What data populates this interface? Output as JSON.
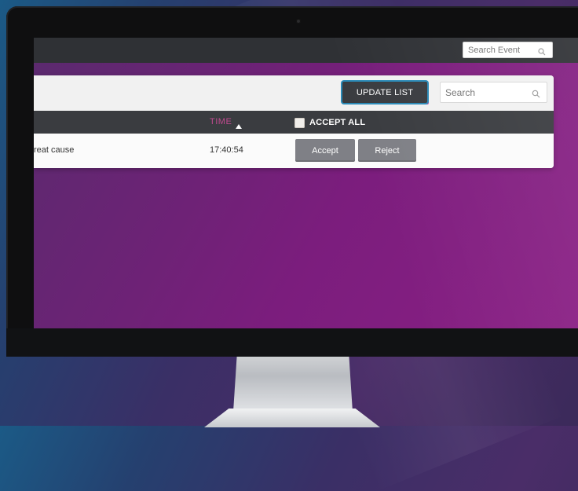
{
  "topbar": {
    "event_search_placeholder": "Search Event"
  },
  "toolbar": {
    "update_list_label": "UPDATE LIST",
    "search_placeholder": "Search"
  },
  "table": {
    "columns": {
      "time_label": "TIME",
      "accept_all_label": "ACCEPT ALL",
      "sort": "ascending"
    },
    "rows": [
      {
        "cause": "reat cause",
        "time": "17:40:54",
        "accept_label": "Accept",
        "reject_label": "Reject"
      }
    ]
  },
  "icons": {
    "search": "search-icon",
    "sort": "sort-up-icon",
    "checkbox": "checkbox-icon"
  },
  "colors": {
    "accent_pink": "#c04a8f",
    "button_gray": "#7f8086",
    "header_dark": "#3a3c40"
  }
}
